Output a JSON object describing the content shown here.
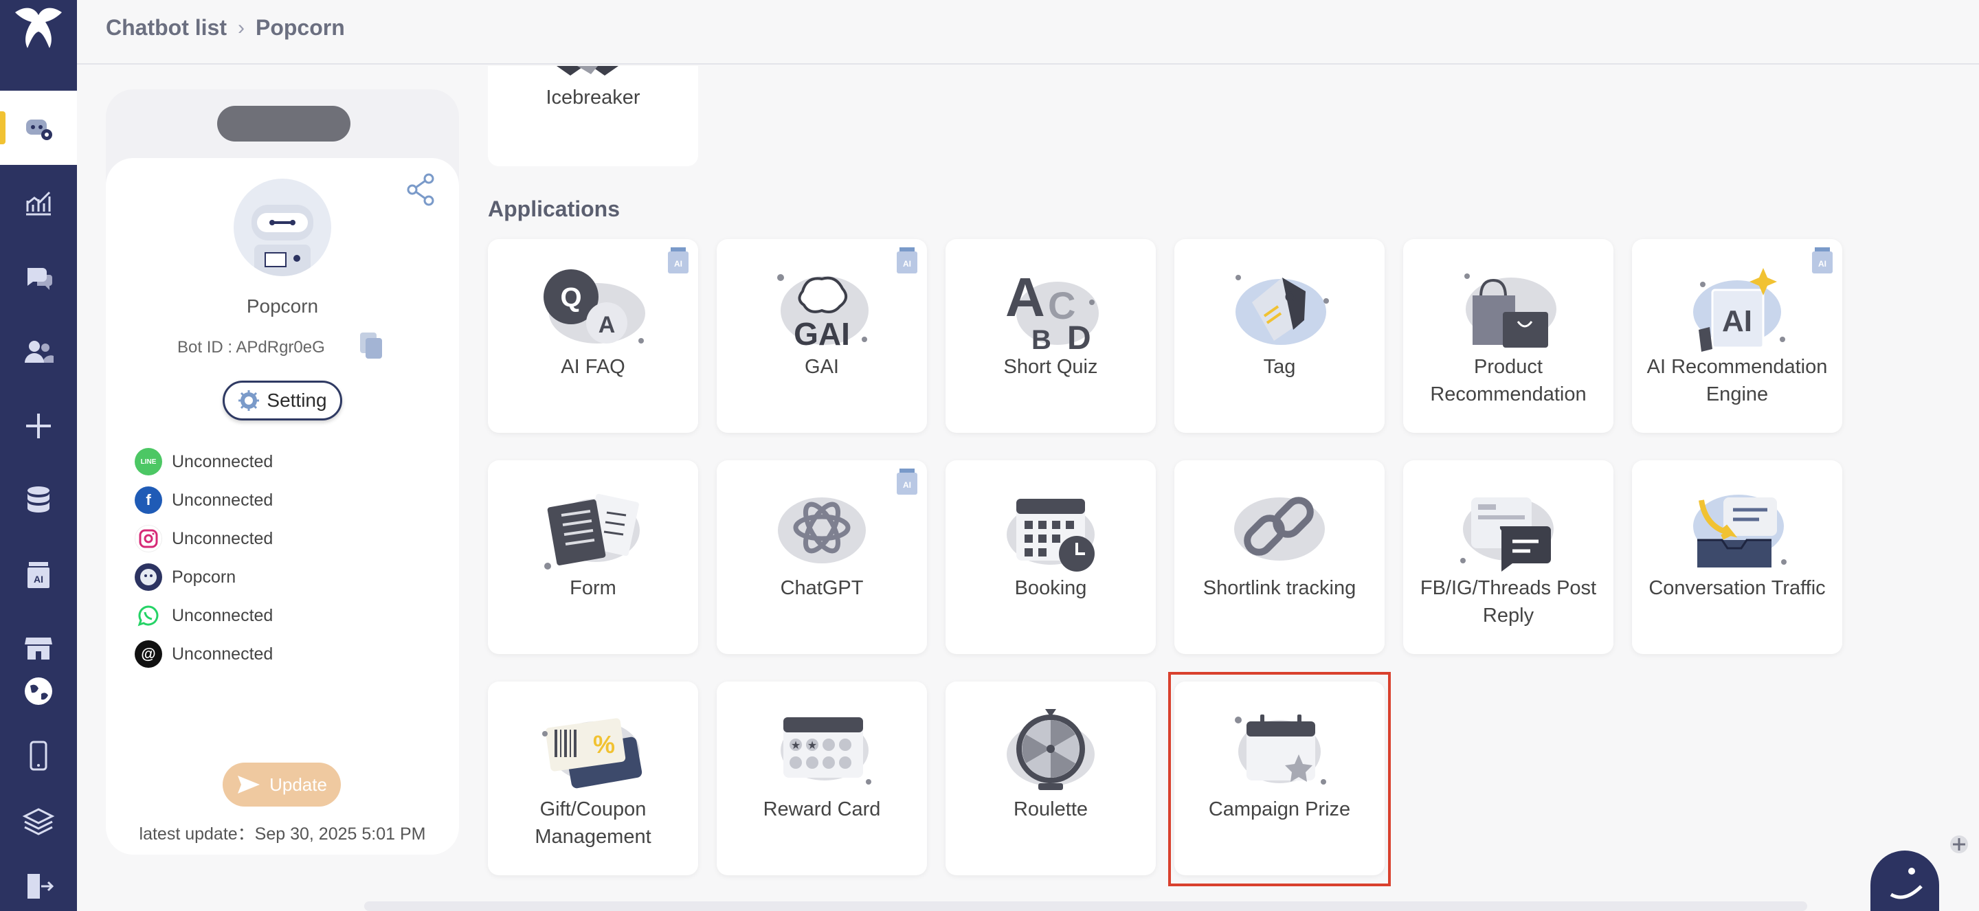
{
  "header": {
    "crumb_root": "Chatbot list",
    "crumb_current": "Popcorn"
  },
  "sidebar": {
    "items": [
      {
        "icon": "robot-settings-icon",
        "active": true
      },
      {
        "icon": "analytics-chart-icon"
      },
      {
        "icon": "chat-bubbles-icon"
      },
      {
        "icon": "users-icon"
      },
      {
        "icon": "plus-icon"
      },
      {
        "icon": "database-icon"
      },
      {
        "icon": "ai-jar-icon"
      },
      {
        "icon": "store-icon"
      },
      {
        "icon": "globe-icon"
      },
      {
        "icon": "mobile-icon"
      },
      {
        "icon": "layers-icon"
      },
      {
        "icon": "logout-icon"
      }
    ]
  },
  "bot": {
    "name": "Popcorn",
    "bot_id_label": "Bot ID : APdRgr0eG",
    "setting_label": "Setting",
    "channels": [
      {
        "platform": "LINE",
        "status": "Unconnected",
        "color": "#4cc764"
      },
      {
        "platform": "Facebook",
        "status": "Unconnected",
        "color": "#1f5bb6"
      },
      {
        "platform": "Instagram",
        "status": "Unconnected",
        "color": "#d62976"
      },
      {
        "platform": "Web",
        "status": "Popcorn",
        "color": "#2c3361"
      },
      {
        "platform": "WhatsApp",
        "status": "Unconnected",
        "color": "#25d366"
      },
      {
        "platform": "Threads",
        "status": "Unconnected",
        "color": "#111111"
      }
    ],
    "update_label": "Update",
    "last_update": "latest update：Sep 30, 2025 5:01 PM"
  },
  "main": {
    "icebreaker_label": "Icebreaker",
    "applications_title": "Applications",
    "ai_badge_text": "AI",
    "tiles": [
      {
        "label": "AI FAQ",
        "ai": true
      },
      {
        "label": "GAI",
        "ai": true
      },
      {
        "label": "Short Quiz",
        "ai": false
      },
      {
        "label": "Tag",
        "ai": false
      },
      {
        "label": "Product Recommendation",
        "ai": false
      },
      {
        "label": "AI Recommendation Engine",
        "ai": true
      },
      {
        "label": "Form",
        "ai": false
      },
      {
        "label": "ChatGPT",
        "ai": true
      },
      {
        "label": "Booking",
        "ai": false
      },
      {
        "label": "Shortlink tracking",
        "ai": false
      },
      {
        "label": "FB/IG/Threads Post Reply",
        "ai": false
      },
      {
        "label": "Conversation Traffic",
        "ai": false
      },
      {
        "label": "Gift/Coupon Management",
        "ai": false
      },
      {
        "label": "Reward Card",
        "ai": false
      },
      {
        "label": "Roulette",
        "ai": false
      },
      {
        "label": "Campaign Prize",
        "ai": false,
        "highlighted": true
      }
    ]
  },
  "colors": {
    "nav_bg": "#2c3361",
    "active_indicator": "#f1c232",
    "highlight_border": "#d9412e",
    "update_button": "#efc9a0"
  }
}
